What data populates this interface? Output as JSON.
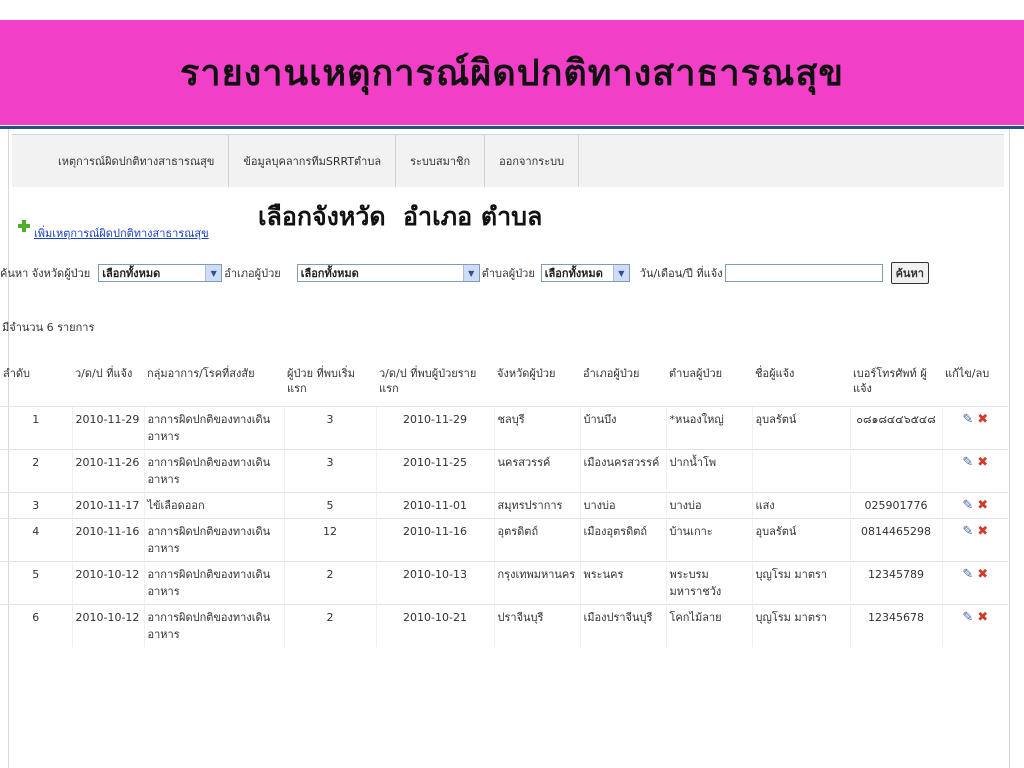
{
  "slide": {
    "title": "รายงานเหตุการณ์ผิดปกติทางสาธารณสุข"
  },
  "nav": {
    "items": [
      "เหตุการณ์ผิดปกติทางสาธารณสุข",
      "ข้อมูลบุคลากรทีมSRRTตำบล",
      "ระบบสมาชิก",
      "ออกจากระบบ"
    ]
  },
  "add_link": "เพิ่มเหตุการณ์ผิดปกติทางสาธารณสุข",
  "overlay_caption": "เลือกจังหวัด  อำเภอ ตำบล",
  "search": {
    "province_label": "ค้นหา จังหวัดผู้ป่วย",
    "province_value": "เลือกทั้งหมด",
    "district_label": "อำเภอผู้ป่วย",
    "district_value": "เลือกทั้งหมด",
    "subdistrict_label": "ตำบลผู้ป่วย",
    "subdistrict_value": "เลือกทั้งหมด",
    "date_label": "วัน/เดือน/ปี ที่แจ้ง",
    "date_value": "",
    "button": "ค้นหา"
  },
  "count_text": "มีจำนวน 6 รายการ",
  "table": {
    "headers": [
      "ลำดับ",
      "ว/ด/ป ที่แจ้ง",
      "กลุ่มอาการ/โรคที่สงสัย",
      "ผู้ป่วย ที่พบเริ่มแรก",
      "ว/ด/ป ที่พบผู้ป่วยรายแรก",
      "จังหวัดผู้ป่วย",
      "อำเภอผู้ป่วย",
      "ตำบลผู้ป่วย",
      "ชื่อผู้แจ้ง",
      "เบอร์โทรศัพท์ ผู้แจ้ง",
      "แก้ไข/ลบ"
    ],
    "rows": [
      [
        "1",
        "2010-11-29",
        "อาการผิดปกติของทางเดินอาหาร",
        "3",
        "2010-11-29",
        "ชลบุรี",
        "บ้านบึง",
        "*หนองใหญ่",
        "อุบลรัตน์",
        "๐๘๑๘๔๔๖๕๔๘"
      ],
      [
        "2",
        "2010-11-26",
        "อาการผิดปกติของทางเดินอาหาร",
        "3",
        "2010-11-25",
        "นครสวรรค์",
        "เมืองนครสวรรค์",
        "ปากน้ำโพ",
        "",
        ""
      ],
      [
        "3",
        "2010-11-17",
        "ไข้เลือดออก",
        "5",
        "2010-11-01",
        "สมุทรปราการ",
        "บางบ่อ",
        "บางบ่อ",
        "แสง",
        "025901776"
      ],
      [
        "4",
        "2010-11-16",
        "อาการผิดปกติของทางเดินอาหาร",
        "12",
        "2010-11-16",
        "อุตรดิตถ์",
        "เมืองอุตรดิตถ์",
        "บ้านเกาะ",
        "อุบลรัตน์",
        "0814465298"
      ],
      [
        "5",
        "2010-10-12",
        "อาการผิดปกติของทางเดินอาหาร",
        "2",
        "2010-10-13",
        "กรุงเทพมหานคร",
        "พระนคร",
        "พระบรมมหาราชวัง",
        "บุญโรม มาตรา",
        "12345789"
      ],
      [
        "6",
        "2010-10-12",
        "อาการผิดปกติของทางเดินอาหาร",
        "2",
        "2010-10-21",
        "ปราจีนบุรี",
        "เมืองปราจีนบุรี",
        "โคกไม้ลาย",
        "บุญโรม มาตรา",
        "12345678"
      ]
    ]
  },
  "icons": {
    "edit": "pencil-icon",
    "delete": "x-icon"
  },
  "colors": {
    "banner": "#f13fc8",
    "link": "#1a3fbf",
    "delete": "#d23a2a"
  }
}
